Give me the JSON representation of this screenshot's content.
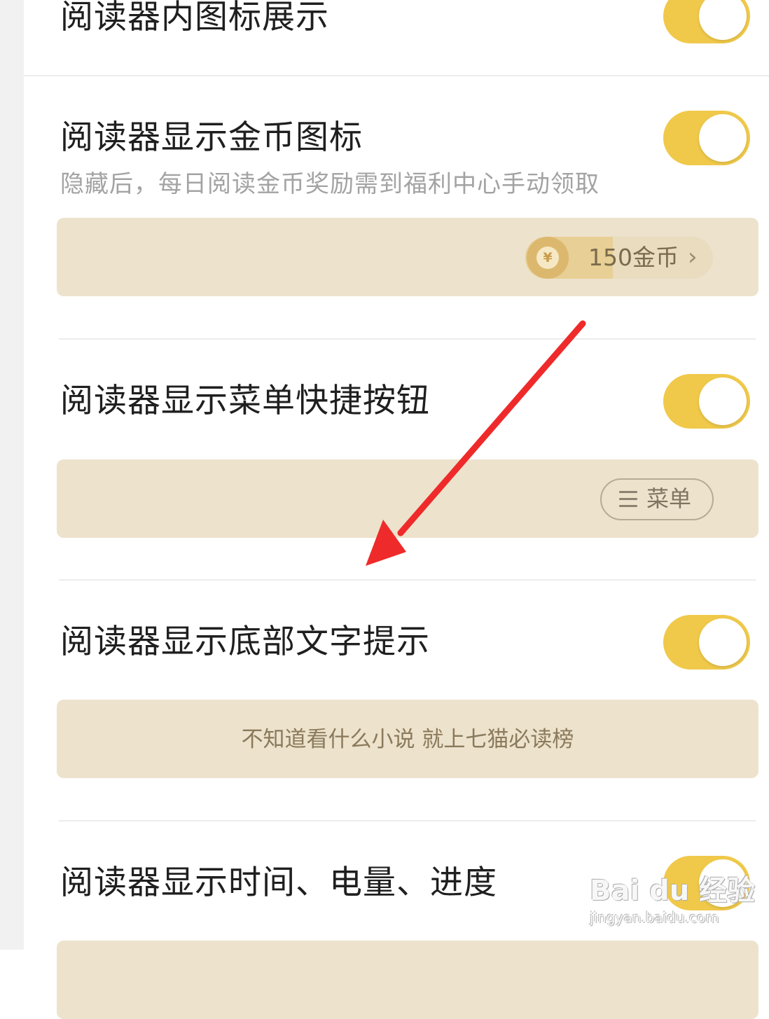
{
  "settings": {
    "items": [
      {
        "title": "阅读器内图标展示",
        "toggle_on": true
      },
      {
        "title": "阅读器显示金币图标",
        "subtitle": "隐藏后，每日阅读金币奖励需到福利中心手动领取",
        "toggle_on": true,
        "preview": {
          "coin_symbol": "¥",
          "coin_text": "150金币",
          "chevron": "›"
        }
      },
      {
        "title": "阅读器显示菜单快捷按钮",
        "toggle_on": true,
        "preview": {
          "menu_label": "菜单"
        }
      },
      {
        "title": "阅读器显示底部文字提示",
        "toggle_on": true,
        "preview": {
          "hint_text": "不知道看什么小说 就上七猫必读榜"
        }
      },
      {
        "title": "阅读器显示时间、电量、进度",
        "toggle_on": true
      }
    ]
  },
  "colors": {
    "toggle_on": "#f0c94a",
    "preview_bg": "#ede2cc",
    "annotation_arrow": "#ef2a2a"
  },
  "icons": [
    "coin-icon",
    "menu-lines-icon",
    "chevron-right-icon",
    "annotation-arrow"
  ],
  "watermark": {
    "logo": "Bai du 经验",
    "url": "jingyan.baidu.com"
  }
}
